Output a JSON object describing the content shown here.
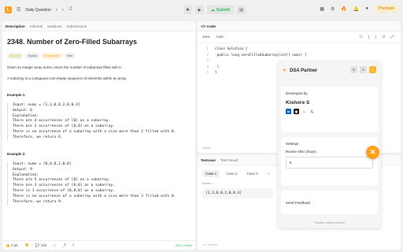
{
  "topbar": {
    "daily_question": "Daily Question",
    "submit_label": "Submit",
    "premium_label": "Premium"
  },
  "description": {
    "tabs": [
      "Description",
      "Editorial",
      "Solutions",
      "Submissions"
    ],
    "title": "2348. Number of Zero-Filled Subarrays",
    "tags": [
      "Medium",
      "Topics",
      "Companies",
      "Hint"
    ],
    "para1": "Given an integer array nums, return the number of subarrays filled with 0.",
    "para2": "A subarray is a contiguous non-empty sequence of elements within an array.",
    "example1_title": "Example 1:",
    "example1_lines": [
      "Input: nums = [1,3,0,0,2,0,0,4]",
      "Output: 6",
      "Explanation:",
      "There are 4 occurrences of [0] as a subarray.",
      "There are 2 occurrences of [0,0] as a subarray.",
      "There is no occurrence of a subarray with a size more than 2 filled with 0.",
      "Therefore, we return 6."
    ],
    "example2_title": "Example 2:",
    "example2_lines": [
      "Input: nums = [0,0,0,2,0,0]",
      "Output: 9",
      "Explanation:",
      "There are 5 occurrences of [0] as a subarray.",
      "There are 3 occurrences of [0,0] as a subarray.",
      "There is 1 occurrence of [0,0,0] as a subarray.",
      "There is no occurrence of a subarray with a size more than 3 filled with 0.",
      "Therefore, we return 9."
    ],
    "likes": "2.6K",
    "comments": "155",
    "online": "5211 Online"
  },
  "code": {
    "tab_label": "Code",
    "language": "Java",
    "mode": "Auto",
    "lines": [
      "class Solution {",
      "    public long zeroFilledSubarray(int[] nums) {",
      "",
      "    }",
      "}"
    ],
    "saved": "Saved"
  },
  "testcase": {
    "tab_label": "Testcase",
    "result_label": "Test Result",
    "cases": [
      "Case 1",
      "Case 2",
      "Case 3"
    ],
    "field_label": "nums =",
    "value": "[1,3,0,0,2,0,0,4]",
    "source": "Source"
  },
  "dsa_partner": {
    "title": "DSA Partner",
    "developed_by": "Developed by",
    "developer": "Kishore S",
    "settings_label": "Settings",
    "revise_label": "Revise After (Days)",
    "revise_value": "5",
    "feedback_label": "Send Feedback",
    "footer": "Practice makes perfect"
  },
  "colors": {
    "accent": "#ffa116",
    "submit_green": "#2cbb5d"
  }
}
